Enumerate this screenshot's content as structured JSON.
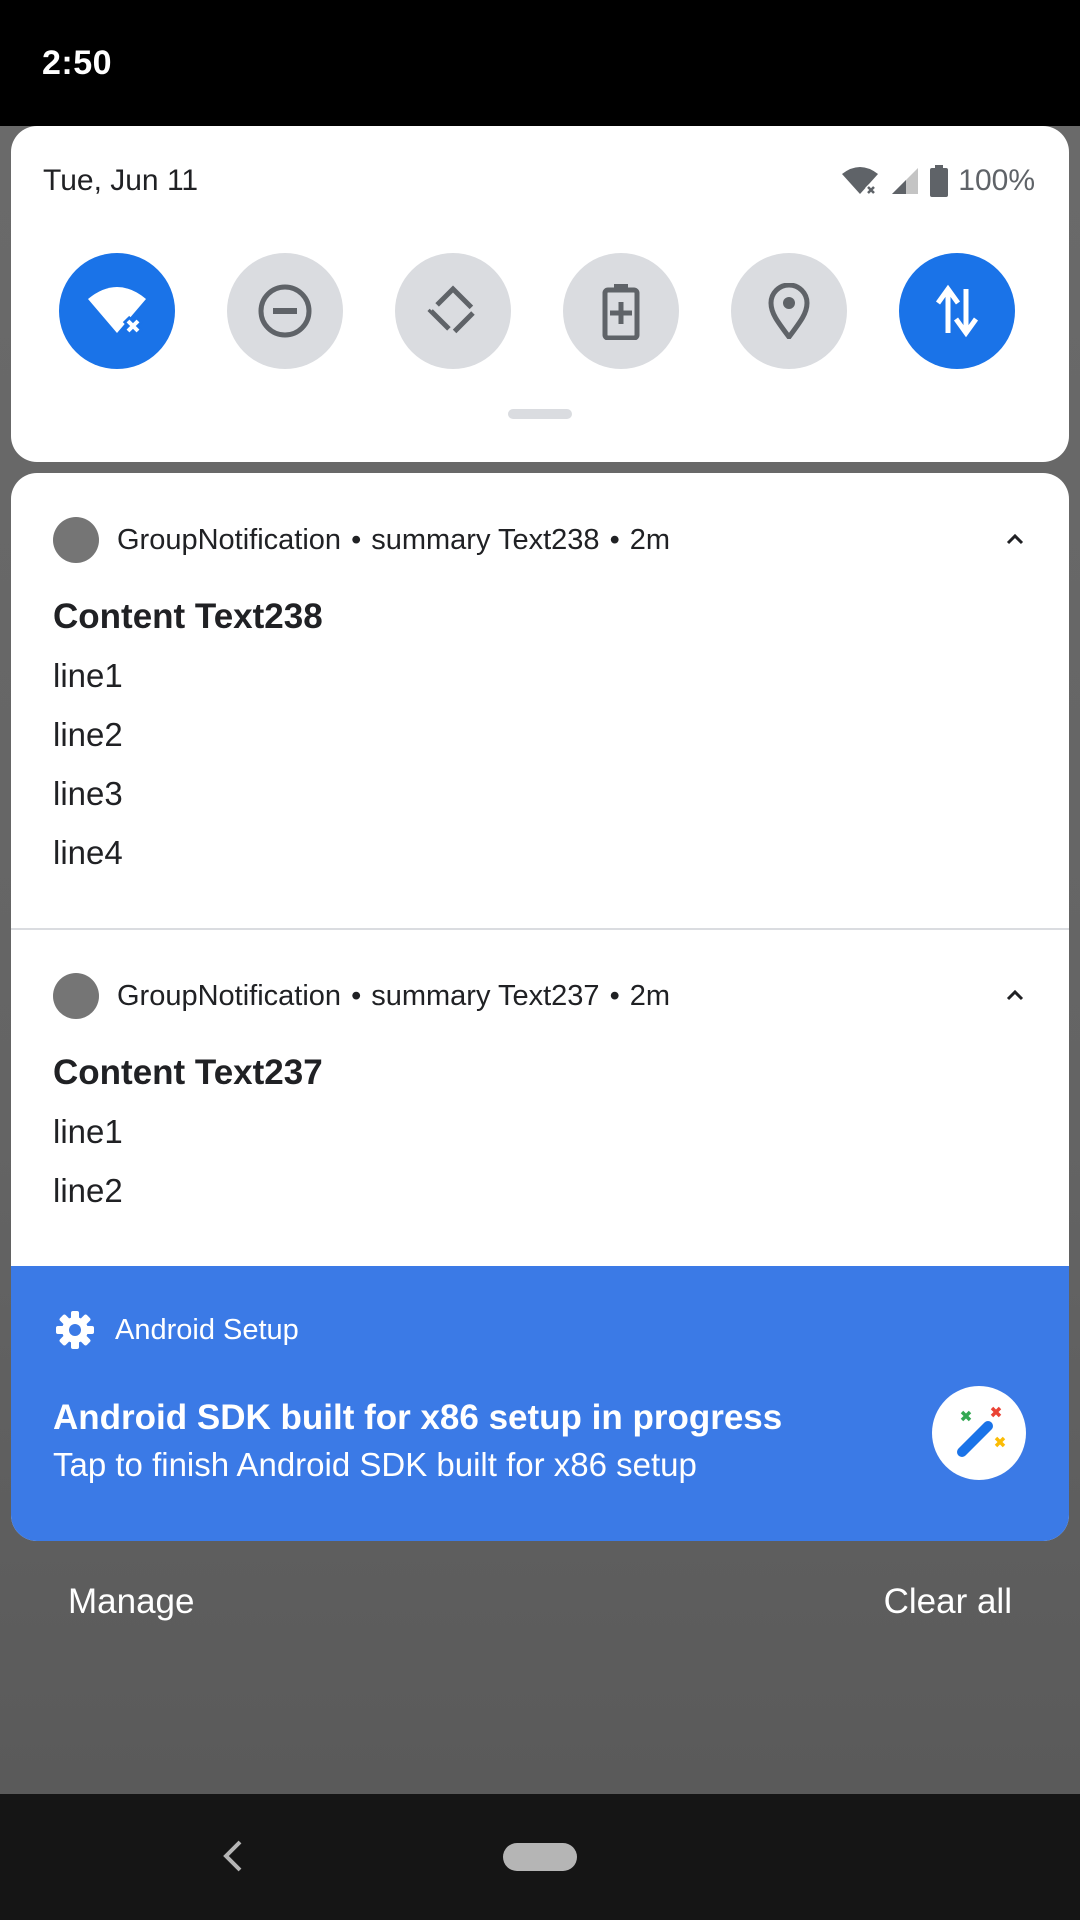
{
  "status_bar": {
    "time": "2:50"
  },
  "quick_settings": {
    "date": "Tue, Jun 11",
    "battery": "100%",
    "tiles": [
      {
        "name": "wifi",
        "state": "on"
      },
      {
        "name": "do-not-disturb",
        "state": "off"
      },
      {
        "name": "auto-rotate",
        "state": "off"
      },
      {
        "name": "battery-saver",
        "state": "off"
      },
      {
        "name": "location",
        "state": "off"
      },
      {
        "name": "mobile-data",
        "state": "on"
      }
    ]
  },
  "notifications": [
    {
      "app": "GroupNotification",
      "summary": "summary Text238",
      "time": "2m",
      "title": "Content Text238",
      "lines": [
        "line1",
        "line2",
        "line3",
        "line4"
      ]
    },
    {
      "app": "GroupNotification",
      "summary": "summary Text237",
      "time": "2m",
      "title": "Content Text237",
      "lines": [
        "line1",
        "line2"
      ]
    }
  ],
  "setup_notification": {
    "app": "Android Setup",
    "title": "Android SDK built for x86 setup in progress",
    "text": "Tap to finish Android SDK built for x86 setup"
  },
  "footer": {
    "manage": "Manage",
    "clear_all": "Clear all"
  },
  "colors": {
    "accent": "#1a73e8",
    "setup_bg": "#3b7ae6"
  },
  "separator": "•"
}
